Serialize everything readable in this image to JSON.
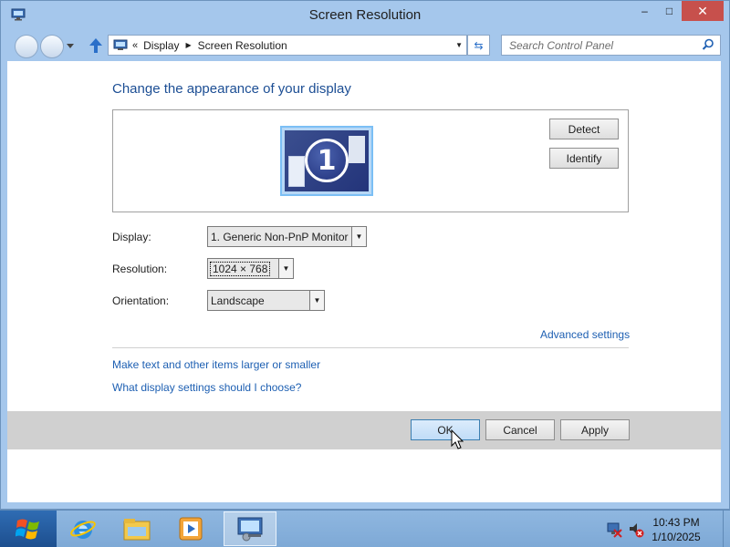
{
  "window": {
    "title": "Screen Resolution",
    "minimize_glyph": "–",
    "maximize_glyph": "□",
    "close_glyph": "✕"
  },
  "address_bar": {
    "chevron": "«",
    "crumbs": [
      "Display",
      "Screen Resolution"
    ],
    "separator": "▶",
    "dropdown_glyph": "▼",
    "refresh_glyph": "⇆"
  },
  "search": {
    "placeholder": "Search Control Panel"
  },
  "page": {
    "heading": "Change the appearance of your display",
    "monitor_number": "1",
    "detect_label": "Detect",
    "identify_label": "Identify"
  },
  "fields": {
    "display_label": "Display:",
    "display_value": "1. Generic Non-PnP Monitor",
    "resolution_label": "Resolution:",
    "resolution_value": "1024 × 768",
    "orientation_label": "Orientation:",
    "orientation_value": "Landscape",
    "dropdown_glyph": "▼"
  },
  "links": {
    "advanced": "Advanced settings",
    "text_size": "Make text and other items larger or smaller",
    "help": "What display settings should I choose?"
  },
  "buttons": {
    "ok": "OK",
    "cancel": "Cancel",
    "apply": "Apply"
  },
  "taskbar": {
    "items": [
      "start-button",
      "internet-explorer-icon",
      "file-explorer-icon",
      "media-player-icon",
      "control-panel-icon"
    ],
    "active_item": "control-panel-icon",
    "time": "10:43 PM",
    "date": "1/10/2025"
  },
  "colors": {
    "link": "#1d5fb2",
    "heading": "#1c4e94",
    "close_button": "#c7504c",
    "frame": "#a5c7ec",
    "taskbar": "#8fb7e0"
  }
}
